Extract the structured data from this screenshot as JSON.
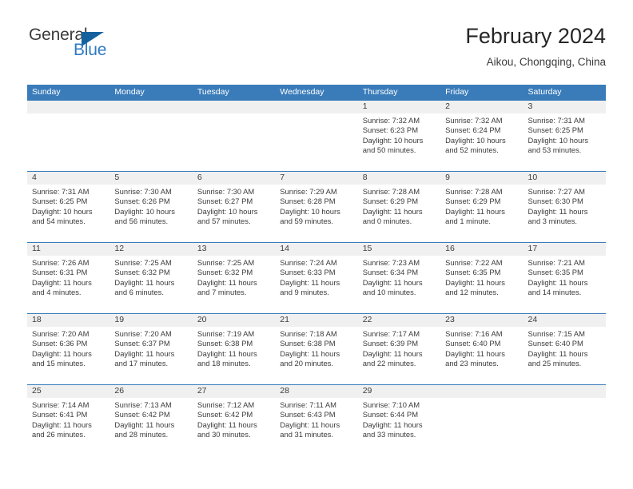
{
  "brand": {
    "name_part1": "General",
    "name_part2": "Blue",
    "triangle_icon": "triangle-icon",
    "accent_color": "#2f7ac4",
    "triangle_color": "#14619e"
  },
  "header": {
    "title": "February 2024",
    "subtitle": "Aikou, Chongqing, China",
    "header_bg_color": "#3a7cba",
    "date_band_color": "#f0f0f0"
  },
  "weekdays": [
    "Sunday",
    "Monday",
    "Tuesday",
    "Wednesday",
    "Thursday",
    "Friday",
    "Saturday"
  ],
  "weeks": [
    {
      "days": [
        {
          "num": "",
          "lines": []
        },
        {
          "num": "",
          "lines": []
        },
        {
          "num": "",
          "lines": []
        },
        {
          "num": "",
          "lines": []
        },
        {
          "num": "1",
          "lines": [
            "Sunrise: 7:32 AM",
            "Sunset: 6:23 PM",
            "Daylight: 10 hours",
            "and 50 minutes."
          ]
        },
        {
          "num": "2",
          "lines": [
            "Sunrise: 7:32 AM",
            "Sunset: 6:24 PM",
            "Daylight: 10 hours",
            "and 52 minutes."
          ]
        },
        {
          "num": "3",
          "lines": [
            "Sunrise: 7:31 AM",
            "Sunset: 6:25 PM",
            "Daylight: 10 hours",
            "and 53 minutes."
          ]
        }
      ]
    },
    {
      "days": [
        {
          "num": "4",
          "lines": [
            "Sunrise: 7:31 AM",
            "Sunset: 6:25 PM",
            "Daylight: 10 hours",
            "and 54 minutes."
          ]
        },
        {
          "num": "5",
          "lines": [
            "Sunrise: 7:30 AM",
            "Sunset: 6:26 PM",
            "Daylight: 10 hours",
            "and 56 minutes."
          ]
        },
        {
          "num": "6",
          "lines": [
            "Sunrise: 7:30 AM",
            "Sunset: 6:27 PM",
            "Daylight: 10 hours",
            "and 57 minutes."
          ]
        },
        {
          "num": "7",
          "lines": [
            "Sunrise: 7:29 AM",
            "Sunset: 6:28 PM",
            "Daylight: 10 hours",
            "and 59 minutes."
          ]
        },
        {
          "num": "8",
          "lines": [
            "Sunrise: 7:28 AM",
            "Sunset: 6:29 PM",
            "Daylight: 11 hours",
            "and 0 minutes."
          ]
        },
        {
          "num": "9",
          "lines": [
            "Sunrise: 7:28 AM",
            "Sunset: 6:29 PM",
            "Daylight: 11 hours",
            "and 1 minute."
          ]
        },
        {
          "num": "10",
          "lines": [
            "Sunrise: 7:27 AM",
            "Sunset: 6:30 PM",
            "Daylight: 11 hours",
            "and 3 minutes."
          ]
        }
      ]
    },
    {
      "days": [
        {
          "num": "11",
          "lines": [
            "Sunrise: 7:26 AM",
            "Sunset: 6:31 PM",
            "Daylight: 11 hours",
            "and 4 minutes."
          ]
        },
        {
          "num": "12",
          "lines": [
            "Sunrise: 7:25 AM",
            "Sunset: 6:32 PM",
            "Daylight: 11 hours",
            "and 6 minutes."
          ]
        },
        {
          "num": "13",
          "lines": [
            "Sunrise: 7:25 AM",
            "Sunset: 6:32 PM",
            "Daylight: 11 hours",
            "and 7 minutes."
          ]
        },
        {
          "num": "14",
          "lines": [
            "Sunrise: 7:24 AM",
            "Sunset: 6:33 PM",
            "Daylight: 11 hours",
            "and 9 minutes."
          ]
        },
        {
          "num": "15",
          "lines": [
            "Sunrise: 7:23 AM",
            "Sunset: 6:34 PM",
            "Daylight: 11 hours",
            "and 10 minutes."
          ]
        },
        {
          "num": "16",
          "lines": [
            "Sunrise: 7:22 AM",
            "Sunset: 6:35 PM",
            "Daylight: 11 hours",
            "and 12 minutes."
          ]
        },
        {
          "num": "17",
          "lines": [
            "Sunrise: 7:21 AM",
            "Sunset: 6:35 PM",
            "Daylight: 11 hours",
            "and 14 minutes."
          ]
        }
      ]
    },
    {
      "days": [
        {
          "num": "18",
          "lines": [
            "Sunrise: 7:20 AM",
            "Sunset: 6:36 PM",
            "Daylight: 11 hours",
            "and 15 minutes."
          ]
        },
        {
          "num": "19",
          "lines": [
            "Sunrise: 7:20 AM",
            "Sunset: 6:37 PM",
            "Daylight: 11 hours",
            "and 17 minutes."
          ]
        },
        {
          "num": "20",
          "lines": [
            "Sunrise: 7:19 AM",
            "Sunset: 6:38 PM",
            "Daylight: 11 hours",
            "and 18 minutes."
          ]
        },
        {
          "num": "21",
          "lines": [
            "Sunrise: 7:18 AM",
            "Sunset: 6:38 PM",
            "Daylight: 11 hours",
            "and 20 minutes."
          ]
        },
        {
          "num": "22",
          "lines": [
            "Sunrise: 7:17 AM",
            "Sunset: 6:39 PM",
            "Daylight: 11 hours",
            "and 22 minutes."
          ]
        },
        {
          "num": "23",
          "lines": [
            "Sunrise: 7:16 AM",
            "Sunset: 6:40 PM",
            "Daylight: 11 hours",
            "and 23 minutes."
          ]
        },
        {
          "num": "24",
          "lines": [
            "Sunrise: 7:15 AM",
            "Sunset: 6:40 PM",
            "Daylight: 11 hours",
            "and 25 minutes."
          ]
        }
      ]
    },
    {
      "days": [
        {
          "num": "25",
          "lines": [
            "Sunrise: 7:14 AM",
            "Sunset: 6:41 PM",
            "Daylight: 11 hours",
            "and 26 minutes."
          ]
        },
        {
          "num": "26",
          "lines": [
            "Sunrise: 7:13 AM",
            "Sunset: 6:42 PM",
            "Daylight: 11 hours",
            "and 28 minutes."
          ]
        },
        {
          "num": "27",
          "lines": [
            "Sunrise: 7:12 AM",
            "Sunset: 6:42 PM",
            "Daylight: 11 hours",
            "and 30 minutes."
          ]
        },
        {
          "num": "28",
          "lines": [
            "Sunrise: 7:11 AM",
            "Sunset: 6:43 PM",
            "Daylight: 11 hours",
            "and 31 minutes."
          ]
        },
        {
          "num": "29",
          "lines": [
            "Sunrise: 7:10 AM",
            "Sunset: 6:44 PM",
            "Daylight: 11 hours",
            "and 33 minutes."
          ]
        },
        {
          "num": "",
          "lines": []
        },
        {
          "num": "",
          "lines": []
        }
      ]
    }
  ]
}
